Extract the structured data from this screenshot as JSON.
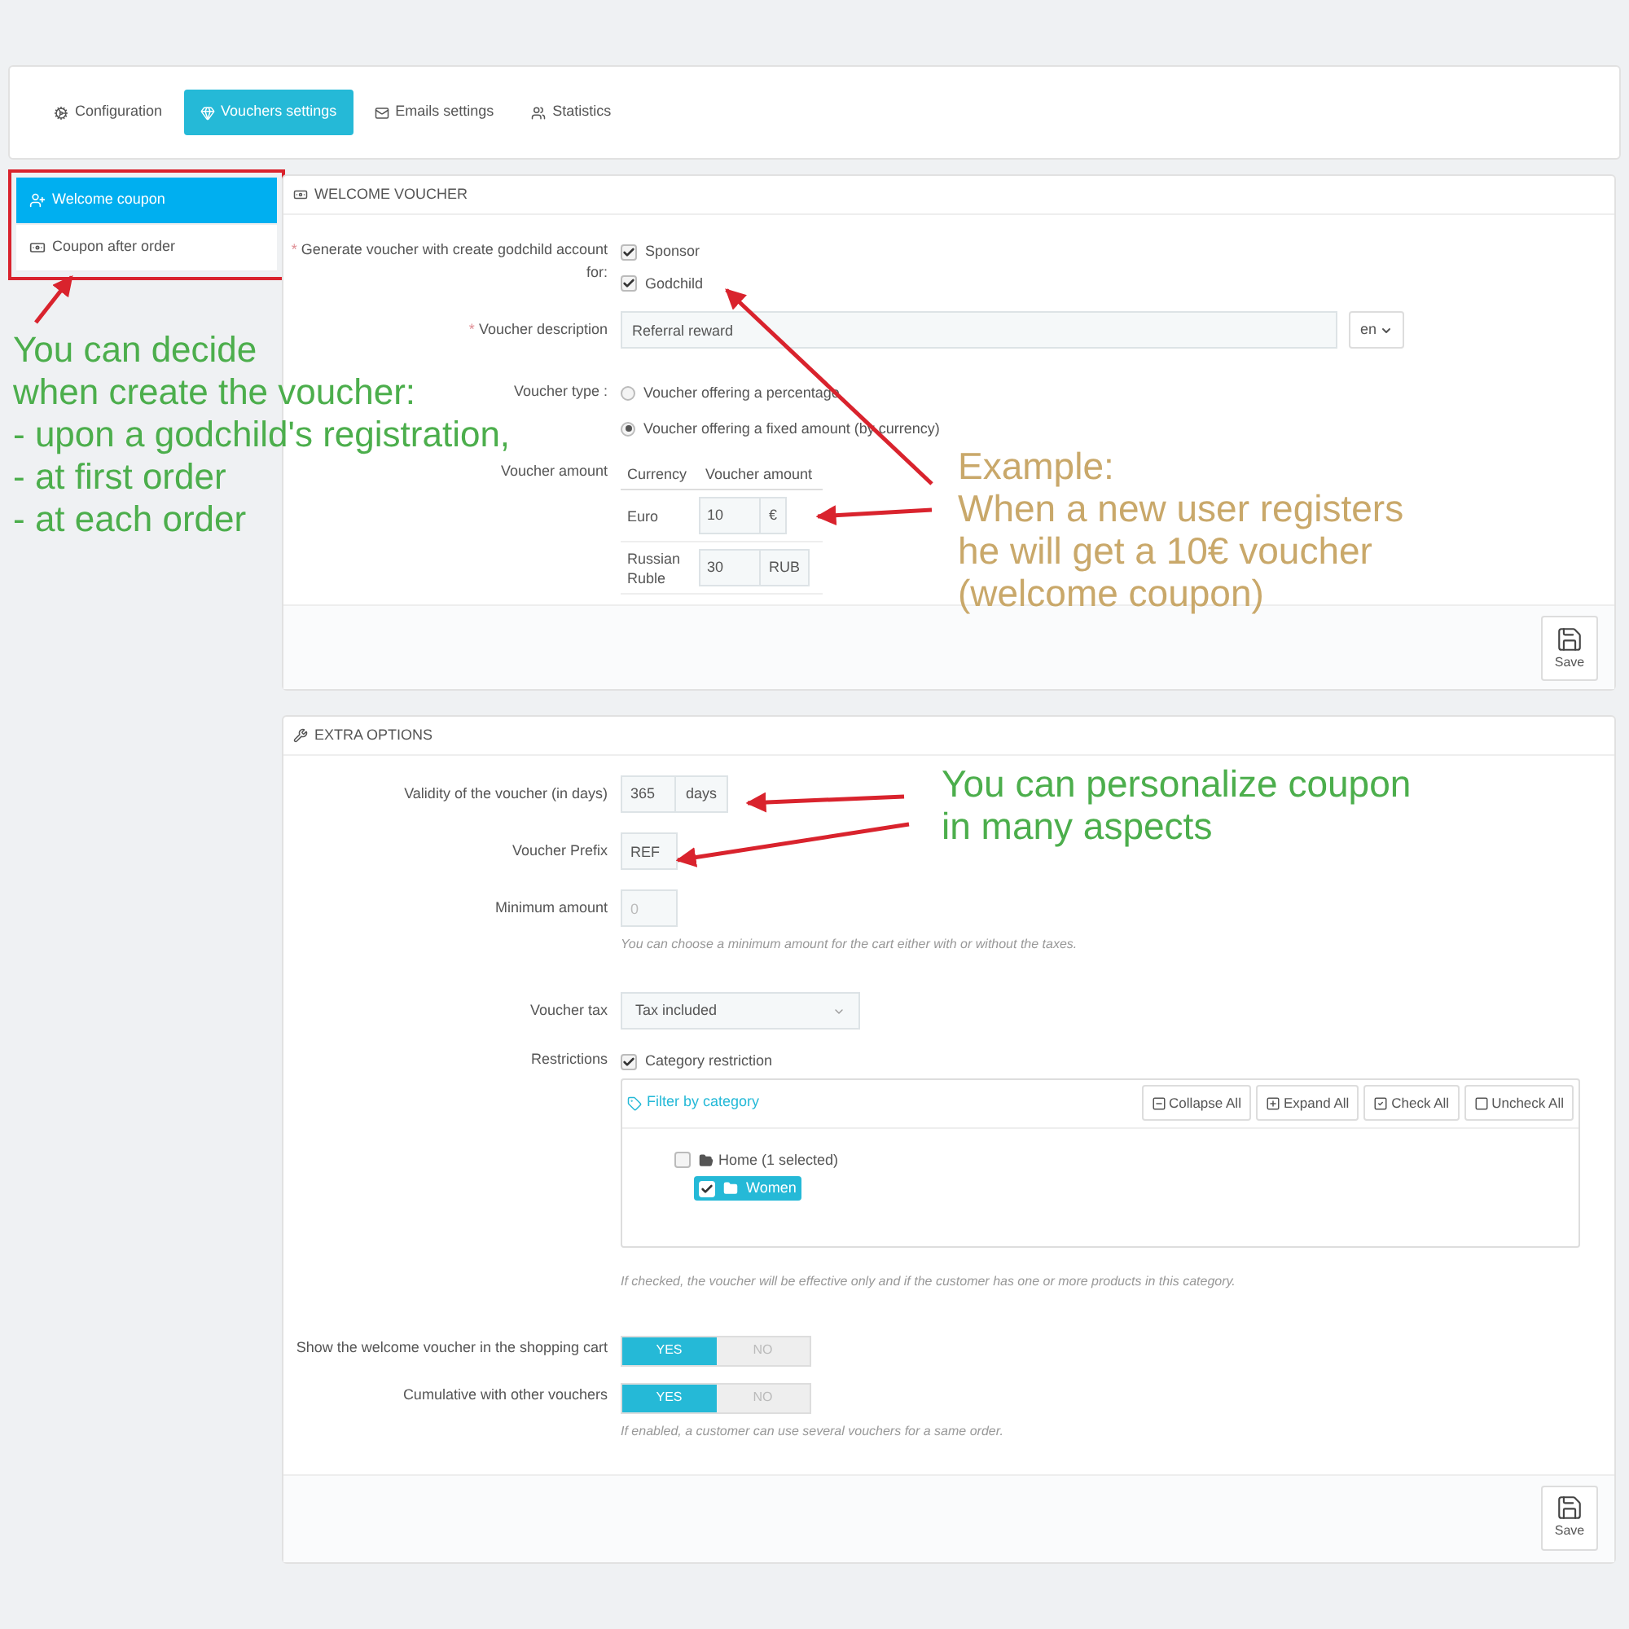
{
  "tabs": [
    {
      "label": "Configuration",
      "selected": false
    },
    {
      "label": "Vouchers settings",
      "selected": true
    },
    {
      "label": "Emails settings",
      "selected": false
    },
    {
      "label": "Statistics",
      "selected": false
    }
  ],
  "side_menu": [
    {
      "label": "Welcome coupon",
      "selected": true
    },
    {
      "label": "Coupon after order",
      "selected": false
    }
  ],
  "welcome_voucher": {
    "title": "WELCOME VOUCHER",
    "generate": {
      "mark": "*",
      "label": "Generate voucher with create godchild account for:",
      "options": [
        {
          "label": "Sponsor",
          "checked": true
        },
        {
          "label": "Godchild",
          "checked": true
        }
      ]
    },
    "description": {
      "mark": "*",
      "label": "Voucher description",
      "value": "Referral reward",
      "language": "en"
    },
    "voucher_type": {
      "label": "Voucher type :",
      "options": [
        {
          "label": "Voucher offering a percentage",
          "selected": false
        },
        {
          "label": "Voucher offering a fixed amount (by currency)",
          "selected": true
        }
      ]
    },
    "amount": {
      "label": "Voucher amount",
      "columns": [
        "Currency",
        "Voucher amount"
      ],
      "rows": [
        {
          "currency": "Euro",
          "value": "10",
          "unit": "€"
        },
        {
          "currency": "Russian Ruble",
          "value": "30",
          "unit": "RUB"
        }
      ]
    },
    "save": "Save"
  },
  "extra_options": {
    "title": "EXTRA OPTIONS",
    "validity": {
      "label": "Validity of the voucher (in days)",
      "value": "365",
      "unit": "days"
    },
    "prefix": {
      "label": "Voucher Prefix",
      "value": "REF"
    },
    "minimum": {
      "label": "Minimum amount",
      "placeholder": "0",
      "help": "You can choose a minimum amount for the cart either with or without the taxes."
    },
    "tax": {
      "label": "Voucher tax",
      "value": "Tax included"
    },
    "restrictions": {
      "label": "Restrictions",
      "checkbox": {
        "label": "Category restriction",
        "checked": true
      },
      "filter": "Filter by category",
      "buttons": [
        "Collapse All",
        "Expand All",
        "Check All",
        "Uncheck All"
      ],
      "tree": [
        {
          "label": "Home (1 selected)",
          "checked": false,
          "expanded": true,
          "children": [
            {
              "label": "Women",
              "checked": true,
              "selected": true
            }
          ]
        }
      ],
      "help": "If checked, the voucher will be effective only and if the customer has one or more products in this category."
    },
    "switches": [
      {
        "label": "Show the welcome voucher in the shopping cart",
        "on": true,
        "yes": "YES",
        "no": "NO"
      },
      {
        "label": "Cumulative with other vouchers",
        "on": true,
        "yes": "YES",
        "no": "NO",
        "help": "If enabled, a customer can use several vouchers for a same order."
      }
    ],
    "save": "Save"
  },
  "annotations": [
    {
      "lines": [
        "You can decide",
        "when create the voucher:",
        "- upon a godchild's registration,",
        "- at first order",
        "- at each order"
      ],
      "color": "#4cae4c"
    },
    {
      "lines": [
        "Example:",
        "When a new user registers",
        "he will get a 10€ voucher",
        "(welcome coupon)"
      ],
      "color": "#c9a86a"
    },
    {
      "lines": [
        "You can personalize coupon",
        "in many aspects"
      ],
      "color": "#4cae4c"
    }
  ]
}
